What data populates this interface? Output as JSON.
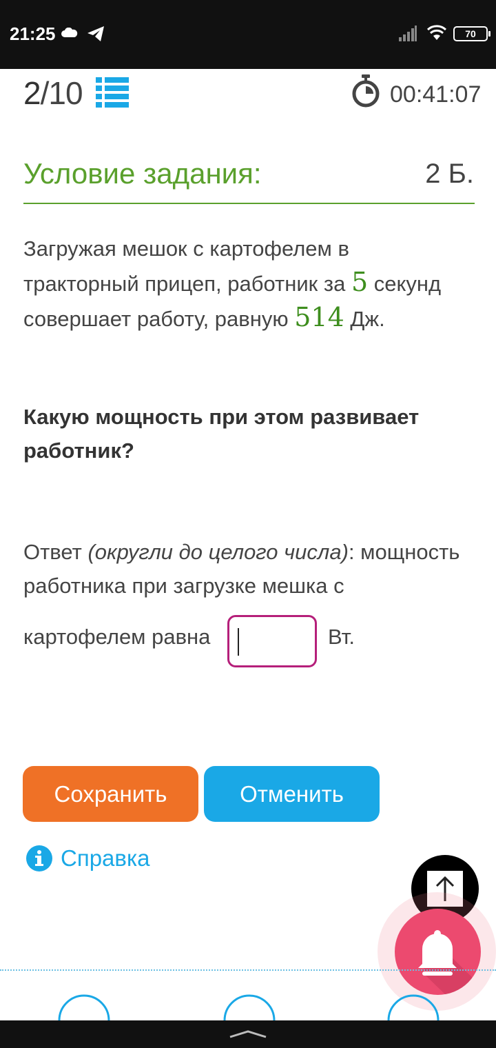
{
  "status_bar": {
    "time": "21:25",
    "battery": "70",
    "icons": [
      "cloud-icon",
      "telegram-icon",
      "signal-icon",
      "wifi-icon",
      "battery-icon"
    ]
  },
  "header": {
    "question_current": "2",
    "question_total": "/10",
    "timer": "00:41:07"
  },
  "section": {
    "title": "Условие задания:",
    "points": "2 Б."
  },
  "task": {
    "part1": "Загружая мешок с картофелем в тракторный прицеп, работник за ",
    "time_value": "5",
    "part2": " секунд совершает работу, равную ",
    "work_value": "514",
    "part3": " Дж."
  },
  "question": "Какую мощность при этом развивает работник?",
  "answer": {
    "prefix": "Ответ ",
    "hint": "(округли до целого числа)",
    "text": ": мощность работника при загрузке мешка с",
    "line2": "картофелем равна",
    "input_value": "",
    "unit": "Вт."
  },
  "buttons": {
    "save": "Сохранить",
    "cancel": "Отменить"
  },
  "help": "Справка",
  "colors": {
    "accent_green": "#5aa02c",
    "save_orange": "#ef7126",
    "cancel_blue": "#1aa8e6",
    "input_border": "#b51f7a",
    "bell_pink": "#ec4a6f"
  }
}
